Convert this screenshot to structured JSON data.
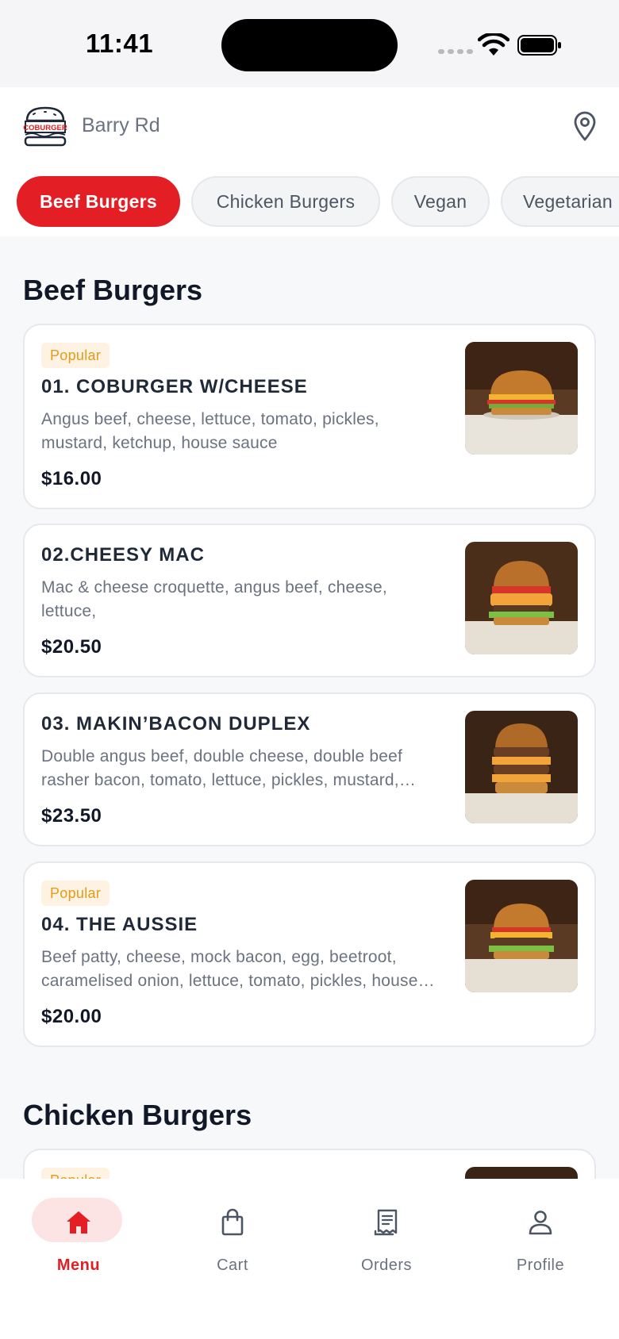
{
  "status_bar": {
    "time": "11:41"
  },
  "header": {
    "logo_text": "COBURGER",
    "store_name": "Barry Rd",
    "location_icon": "map-pin-icon"
  },
  "categories": [
    {
      "label": "Beef Burgers",
      "active": true
    },
    {
      "label": "Chicken Burgers",
      "active": false
    },
    {
      "label": "Vegan",
      "active": false
    },
    {
      "label": "Vegetarian",
      "active": false
    }
  ],
  "sections": [
    {
      "title": "Beef Burgers",
      "items": [
        {
          "badge": "Popular",
          "name": "01. COBURGER W/CHEESE",
          "description": "Angus beef, cheese, lettuce, tomato, pickles, mustard, ketchup, house sauce",
          "price": "$16.00"
        },
        {
          "badge": "",
          "name": "02.CHEESY MAC",
          "description": "Mac & cheese croquette, angus beef, cheese, lettuce,",
          "price": "$20.50"
        },
        {
          "badge": "",
          "name": "03. MAKIN’BACON DUPLEX",
          "description": "Double angus beef, double cheese, double beef rasher bacon, tomato, lettuce, pickles, mustard, ketchup, house sauce",
          "price": "$23.50"
        },
        {
          "badge": "Popular",
          "name": "04. THE AUSSIE",
          "description": "Beef patty, cheese, mock bacon, egg, beetroot, caramelised onion, lettuce, tomato, pickles, house sauce",
          "price": "$20.00"
        }
      ]
    },
    {
      "title": "Chicken Burgers",
      "items": [
        {
          "badge": "Popular"
        }
      ]
    }
  ],
  "bottom_nav": [
    {
      "label": "Menu",
      "icon": "home-icon",
      "active": true
    },
    {
      "label": "Cart",
      "icon": "shopping-bag-icon",
      "active": false
    },
    {
      "label": "Orders",
      "icon": "receipt-icon",
      "active": false
    },
    {
      "label": "Profile",
      "icon": "user-icon",
      "active": false
    }
  ],
  "colors": {
    "accent": "#E31E24",
    "badge_bg": "#FEF3E2",
    "badge_text": "#E59A1A",
    "background": "#F7F8FA"
  }
}
